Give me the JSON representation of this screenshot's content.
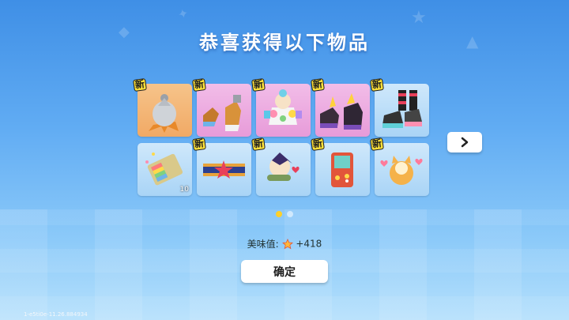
{
  "title": "恭喜获得以下物品",
  "items": [
    {
      "name": "hair-item-icon",
      "new_label": "新",
      "bg": "orange"
    },
    {
      "name": "boots-item-icon",
      "new_label": "新",
      "bg": "pink"
    },
    {
      "name": "clown-item-icon",
      "new_label": "新",
      "bg": "pink"
    },
    {
      "name": "dark-boots-item-icon",
      "new_label": "新",
      "bg": "pink"
    },
    {
      "name": "sneakers-item-icon",
      "new_label": "新",
      "bg": "blue"
    },
    {
      "name": "rainbow-card-item-icon",
      "new_label": "",
      "bg": "blue",
      "quantity": "10"
    },
    {
      "name": "star-belt-item-icon",
      "new_label": "新",
      "bg": "blue"
    },
    {
      "name": "ninja-emote-item-icon",
      "new_label": "新",
      "bg": "blue"
    },
    {
      "name": "game-device-item-icon",
      "new_label": "新",
      "bg": "blue"
    },
    {
      "name": "cat-emote-item-icon",
      "new_label": "新",
      "bg": "blue"
    }
  ],
  "pagination": {
    "current": 1,
    "total": 2
  },
  "deliciousness": {
    "label": "美味值:",
    "value": "+418"
  },
  "confirm_label": "确定",
  "version": "1-e5ti0e-11.26.884934",
  "colors": {
    "accent_yellow": "#ffd02a",
    "new_tag": "#ffe23a"
  }
}
